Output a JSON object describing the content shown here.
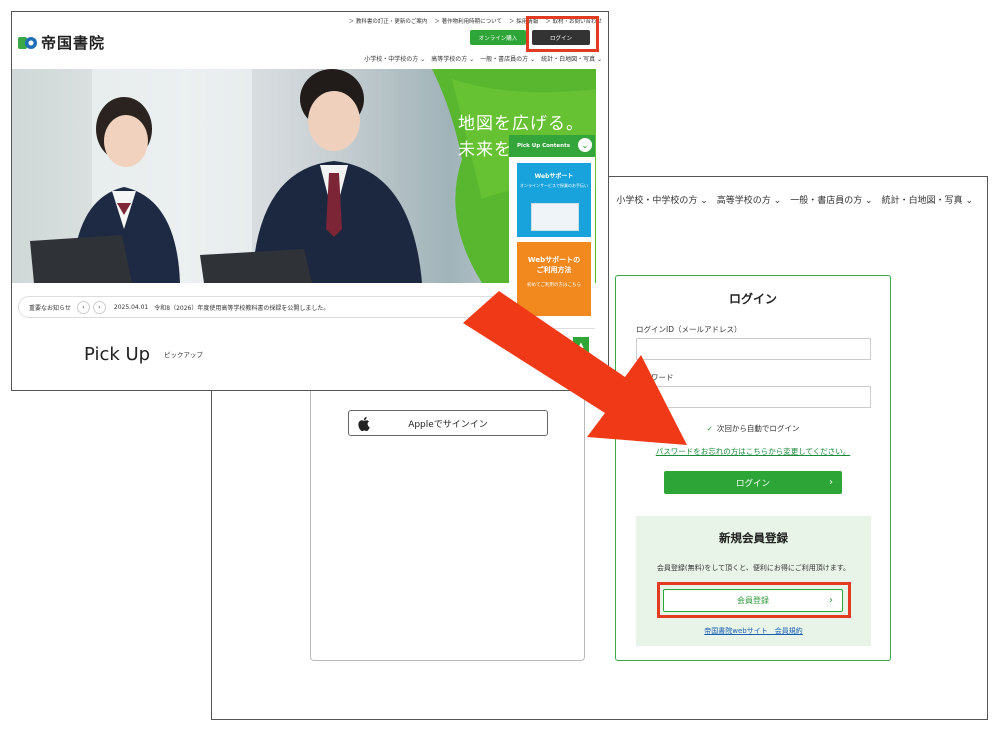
{
  "back_window": {
    "nav": [
      "小学校・中学校の方 ⌄",
      "高等学校の方 ⌄",
      "一般・書店員の方 ⌄",
      "統計・白地図・写真 ⌄"
    ],
    "apple_signin_label": "Appleでサインイン",
    "login": {
      "title": "ログイン",
      "id_label": "ログインID（メールアドレス）",
      "password_label": "パスワード",
      "remember_label": "次回から自動でログイン",
      "forgot_link": "パスワードをお忘れの方はこちらから変更してください。",
      "login_button": "ログイン"
    },
    "register": {
      "title": "新規会員登録",
      "description": "会員登録(無料)をして頂くと、便利にお得にご利用頂けます。",
      "button": "会員登録",
      "terms_link": "帝国書院webサイト　会員規約"
    }
  },
  "front_window": {
    "top_links": [
      "＞ 教科書の訂正・更新のご案内",
      "＞ 著作物利用時期について",
      "＞ 採用情報",
      "＞ 取材・お問い合わせ"
    ],
    "logo_text": "帝国書院",
    "online_button": "オンライン購入",
    "login_button": "ログイン",
    "nav": [
      "小学校・中学校の方 ⌄",
      "高等学校の方 ⌄",
      "一般・書店員の方 ⌄",
      "統計・白地図・写真 ⌄"
    ],
    "hero_line1": "地図を広げる。",
    "hero_line2": "未来を",
    "pickup_contents": "Pick Up Contents",
    "card_web_title": "Webサポート",
    "card_web_sub": "オンラインサービスで授業のお手伝い",
    "card_how_title": "Webサポートの\nご利用方法",
    "card_how_sub": "初めてご利用の方はこちら",
    "news_label": "重要なお知らせ",
    "news_date": "2025.04.01",
    "news_text": "令和8（2026）年度使用高等学校教科書の採録を公開しました。",
    "pickup_title": "Pick Up",
    "pickup_sub": "ピックアップ"
  },
  "colors": {
    "highlight": "#e33b22",
    "brand_green": "#2ea637",
    "arrow": "#f03a17",
    "web_card": "#18a3dc",
    "how_card": "#f1891f"
  }
}
